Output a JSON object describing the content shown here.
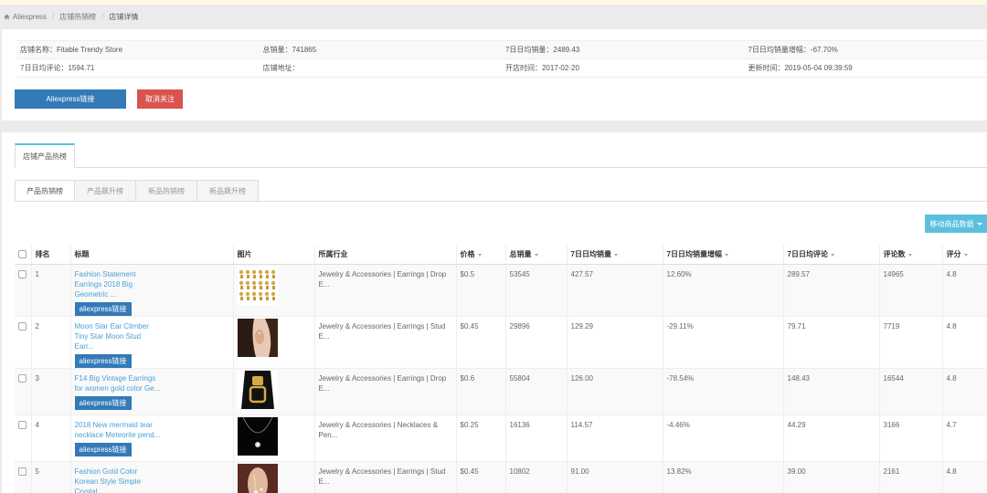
{
  "breadcrumb": {
    "home": "Aliexpress",
    "level2": "店铺热销榜",
    "current": "店铺详情"
  },
  "store_info": {
    "name": "店铺名称：Fitable Trendy Store",
    "total_sales": "总销量：741865",
    "sales_7d": "7日日均销量：2489.43",
    "sales_growth_7d": "7日日均销量增幅：-67.70%",
    "reviews_7d": "7日日均评论：1594.71",
    "address": "店铺地址：",
    "open_time": "开店时间：2017-02-20",
    "update_time": "更新时间：2019-05-04 09:39:59"
  },
  "buttons": {
    "aliexpress_link": "Aliexpress链接",
    "unfollow": "取消关注",
    "move_data": "移动商品数据",
    "row_link": "aliexpress链接"
  },
  "tabs": {
    "main": "店铺产品热榜",
    "sub": [
      "产品热销榜",
      "产品飙升榜",
      "新品热销榜",
      "新品飙升榜"
    ]
  },
  "table": {
    "headers": {
      "rank": "排名",
      "title": "标题",
      "image": "图片",
      "industry": "所属行业",
      "price": "价格",
      "total_sales": "总销量",
      "sales_7d": "7日日均销量",
      "growth_7d": "7日日均销量增幅",
      "reviews_7d": "7日日均评论",
      "review_count": "评论数",
      "rating": "评分"
    },
    "rows": [
      {
        "rank": "1",
        "title": "Fashion Statement Earrings 2018 Big Geometric ...",
        "industry": "Jewelry & Accessories | Earrings | Drop E...",
        "price": "$0.5",
        "total_sales": "53545",
        "sales_7d": "427.57",
        "growth_7d": "12.60%",
        "reviews_7d": "289.57",
        "review_count": "14965",
        "rating": "4.8",
        "image_icon": "earring-grid-thumbnail"
      },
      {
        "rank": "2",
        "title": "Moon Star Ear Climber Tiny Star Moon Stud Earr...",
        "industry": "Jewelry & Accessories | Earrings | Stud E...",
        "price": "$0.45",
        "total_sales": "29896",
        "sales_7d": "129.29",
        "growth_7d": "-29.11%",
        "reviews_7d": "79.71",
        "review_count": "7719",
        "rating": "4.8",
        "image_icon": "model-ear-thumbnail"
      },
      {
        "rank": "3",
        "title": "F14 Big Vintage Earrings for women gold color Ge...",
        "industry": "Jewelry & Accessories | Earrings | Drop E...",
        "price": "$0.6",
        "total_sales": "55804",
        "sales_7d": "126.00",
        "growth_7d": "-78.54%",
        "reviews_7d": "148.43",
        "review_count": "16544",
        "rating": "4.8",
        "image_icon": "gold-earring-thumbnail"
      },
      {
        "rank": "4",
        "title": "2018 New mermaid tear necklace Meteorite pend...",
        "industry": "Jewelry & Accessories | Necklaces & Pen...",
        "price": "$0.25",
        "total_sales": "16136",
        "sales_7d": "114.57",
        "growth_7d": "-4.46%",
        "reviews_7d": "44.29",
        "review_count": "3166",
        "rating": "4.7",
        "image_icon": "necklace-thumbnail"
      },
      {
        "rank": "5",
        "title": "Fashion Gold Color Korean Style Simple Crystal ...",
        "industry": "Jewelry & Accessories | Earrings | Stud E...",
        "price": "$0.45",
        "total_sales": "10802",
        "sales_7d": "91.00",
        "growth_7d": "13.82%",
        "reviews_7d": "39.00",
        "review_count": "2161",
        "rating": "4.8",
        "image_icon": "crystal-earring-thumbnail"
      }
    ]
  },
  "colors": {
    "primary": "#337ab7",
    "danger": "#d9534f",
    "info": "#5bc0de",
    "link": "#4aa0d8"
  }
}
